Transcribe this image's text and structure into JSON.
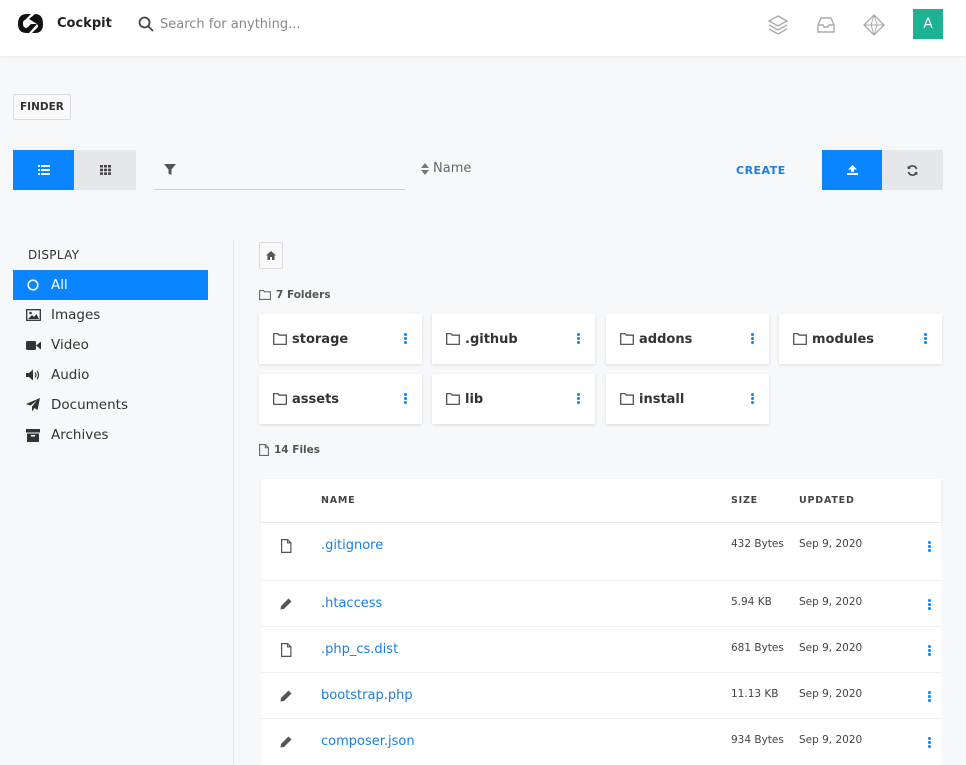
{
  "app": {
    "brand": "Cockpit",
    "avatar_letter": "A"
  },
  "search": {
    "placeholder": "Search for anything..."
  },
  "top_icons": [
    "layers-icon",
    "inbox-icon",
    "diamond-icon"
  ],
  "page_tag": "FINDER",
  "toolbar": {
    "sort_label": "Name",
    "create_label": "CREATE",
    "filter_placeholder": ""
  },
  "sidebar": {
    "title": "DISPLAY",
    "items": [
      {
        "label": "All",
        "icon": "circle-icon",
        "active": true
      },
      {
        "label": "Images",
        "icon": "image-icon"
      },
      {
        "label": "Video",
        "icon": "video-icon"
      },
      {
        "label": "Audio",
        "icon": "volume-icon"
      },
      {
        "label": "Documents",
        "icon": "paper-plane-icon"
      },
      {
        "label": "Archives",
        "icon": "archive-icon"
      }
    ]
  },
  "folders": {
    "count_label": "7 Folders",
    "items": [
      {
        "name": "storage"
      },
      {
        "name": ".github"
      },
      {
        "name": "addons"
      },
      {
        "name": "modules"
      },
      {
        "name": "assets"
      },
      {
        "name": "lib"
      },
      {
        "name": "install"
      }
    ]
  },
  "files": {
    "count_label": "14 Files",
    "headers": {
      "name": "NAME",
      "size": "SIZE",
      "updated": "UPDATED"
    },
    "rows": [
      {
        "name": ".gitignore",
        "size": "432 Bytes",
        "date": "Sep 9, 2020",
        "icon": "file-icon"
      },
      {
        "name": ".htaccess",
        "size": "5.94 KB",
        "date": "Sep 9, 2020",
        "icon": "pencil-icon"
      },
      {
        "name": ".php_cs.dist",
        "size": "681 Bytes",
        "date": "Sep 9, 2020",
        "icon": "file-icon"
      },
      {
        "name": "bootstrap.php",
        "size": "11.13 KB",
        "date": "Sep 9, 2020",
        "icon": "pencil-icon"
      },
      {
        "name": "composer.json",
        "size": "934 Bytes",
        "date": "Sep 9, 2020",
        "icon": "pencil-icon"
      }
    ]
  },
  "colors": {
    "accent": "#0a84ff",
    "link": "#1a7fe0",
    "avatar": "#1bb394"
  }
}
